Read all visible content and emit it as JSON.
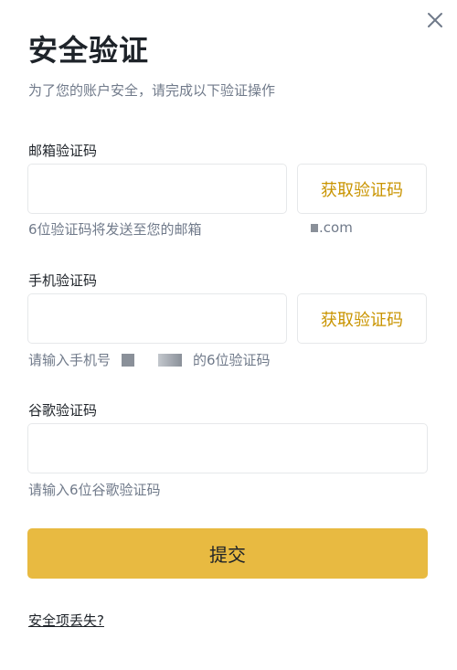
{
  "dialog": {
    "title": "安全验证",
    "subtitle": "为了您的账户安全，请完成以下验证操作"
  },
  "email": {
    "label": "邮箱验证码",
    "value": "",
    "button_label": "获取验证码",
    "hint": "6位验证码将发送至您的邮箱",
    "masked_suffix": ".com"
  },
  "phone": {
    "label": "手机验证码",
    "value": "",
    "button_label": "获取验证码",
    "hint_prefix": "请输入手机号",
    "hint_suffix": "的6位验证码"
  },
  "google": {
    "label": "谷歌验证码",
    "value": "",
    "hint": "请输入6位谷歌验证码"
  },
  "actions": {
    "submit_label": "提交",
    "lost_link_label": "安全项丢失?"
  },
  "colors": {
    "accent": "#e8ba41",
    "link_accent": "#c99400",
    "muted_text": "#707a8a",
    "border": "#e6e8ea"
  },
  "icons": {
    "close": "close-icon"
  }
}
